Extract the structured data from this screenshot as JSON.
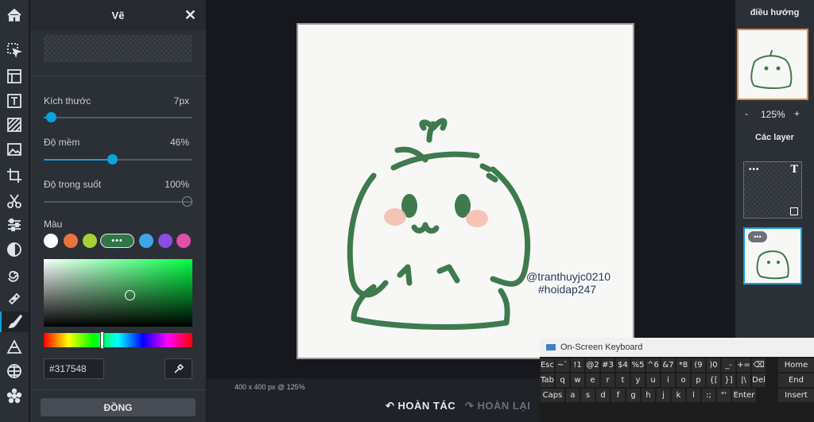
{
  "panel": {
    "title": "Vẽ",
    "close": "✕",
    "done": "ĐỒNG"
  },
  "size": {
    "label": "Kích thước",
    "value": "7px",
    "level": 0.05
  },
  "softness": {
    "label": "Độ mềm",
    "value": "46%",
    "level": 0.46
  },
  "opacity": {
    "label": "Độ trong suốt",
    "value": "100%",
    "level": 1.0
  },
  "color": {
    "label": "Màu",
    "swatches": [
      "#ffffff",
      "#e8743b",
      "#a3d137",
      "#3ea6e8",
      "#8b4ee0",
      "#e04fa8"
    ],
    "current_hex": "#317548",
    "more_label": "•••"
  },
  "canvas_info": "400 x 400 px @ 125%",
  "bottom": {
    "undo": "HOÀN TÁC",
    "redo": "HOÀN LẠI"
  },
  "artwork": {
    "line1": "@tranthuyjc0210",
    "line2": "#hoidap247",
    "stroke": "#3f7a4e"
  },
  "right": {
    "nav_title": "điều hướng",
    "zoom_minus": "-",
    "zoom_value": "125%",
    "zoom_plus": "+",
    "layers_title": "Các layer"
  },
  "keyboard": {
    "title": "On-Screen Keyboard",
    "row1": [
      "Esc",
      "~`",
      "!1",
      "@2",
      "#3",
      "$4",
      "%5",
      "^6",
      "&7",
      "*8",
      "(9",
      ")0",
      "_-",
      "+=",
      "⌫"
    ],
    "row2": [
      "Tab",
      "q",
      "w",
      "e",
      "r",
      "t",
      "y",
      "u",
      "i",
      "o",
      "p",
      "{[",
      "}]",
      "|\\",
      "Del"
    ],
    "row3": [
      "Caps",
      "a",
      "s",
      "d",
      "f",
      "g",
      "h",
      "j",
      "k",
      "l",
      ":;",
      "\"'",
      "Enter"
    ],
    "side": [
      "Home",
      "End",
      "Insert"
    ]
  }
}
